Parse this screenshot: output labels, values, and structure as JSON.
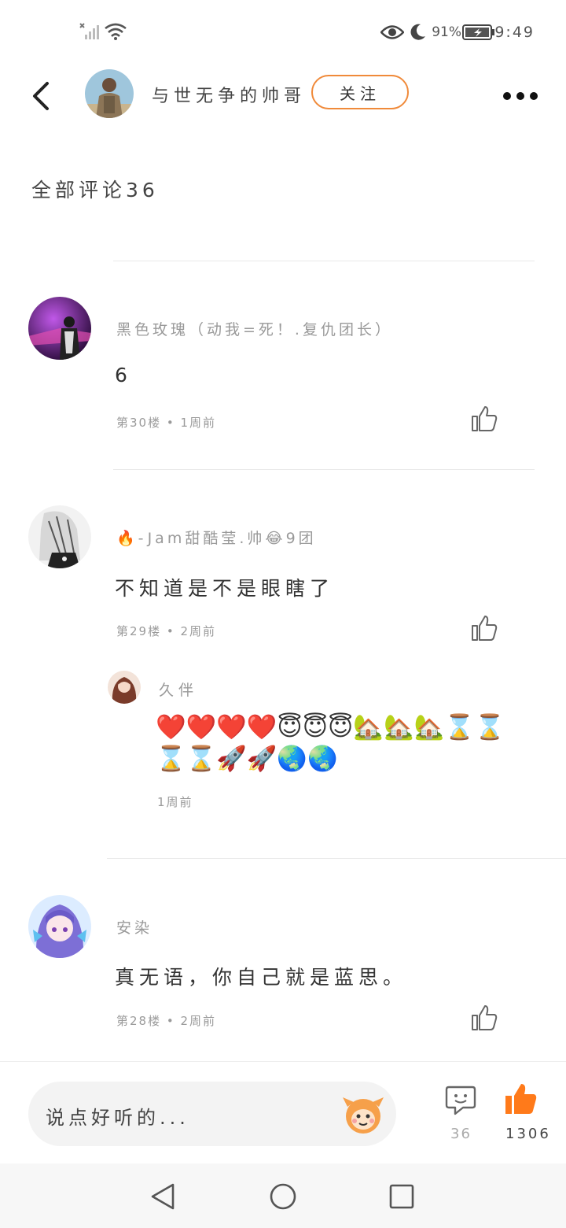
{
  "status_bar": {
    "battery_pct": "91%",
    "time": "9:49"
  },
  "header": {
    "author_name": "与世无争的帅哥",
    "follow_label": "关注"
  },
  "comments_section": {
    "title": "全部评论36"
  },
  "comments": [
    {
      "user": "黑色玫瑰（动我=死！.复仇团长）",
      "text": "6",
      "meta": "第30楼 • 1周前"
    },
    {
      "user": "🔥-Jam甜酷莹.帅😂9团",
      "text": "不知道是不是眼瞎了",
      "meta": "第29楼 • 2周前",
      "reply": {
        "user": "久伴",
        "text": "❤️❤️❤️❤️😇😇😇🏡🏡🏡⌛⌛⌛⌛🚀🚀🌏🌏",
        "meta": "1周前"
      }
    },
    {
      "user": "安染",
      "text": "真无语，你自己就是蓝思。",
      "meta": "第28楼 • 2周前"
    }
  ],
  "bottom_bar": {
    "input_placeholder": "说点好听的...",
    "comment_count": "36",
    "like_count": "1306"
  },
  "colors": {
    "accent": "#f08a3a",
    "like_active": "#ff7a1a"
  }
}
